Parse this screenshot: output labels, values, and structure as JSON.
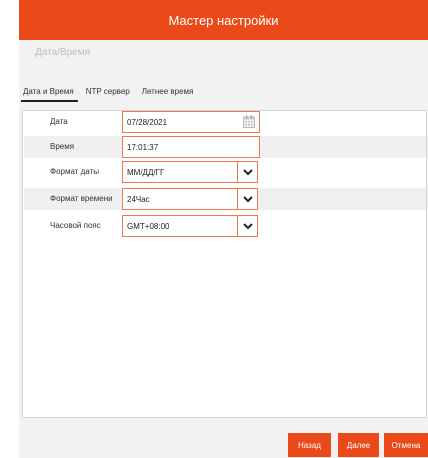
{
  "window": {
    "title": "Мастер настройки"
  },
  "section": {
    "title": "Дата/Время"
  },
  "tabs": [
    {
      "label": "Дата и Время"
    },
    {
      "label": "NTP сервер"
    },
    {
      "label": "Летнее время"
    }
  ],
  "form": {
    "date": {
      "label": "Дата",
      "value": "07/28/2021",
      "icon": "calendar-icon"
    },
    "time": {
      "label": "Время",
      "value": "17:01:37"
    },
    "date_format": {
      "label": "Формат даты",
      "value": "ММ/ДД/ГГ"
    },
    "time_format": {
      "label": "Формат времени",
      "value": "24Час"
    },
    "timezone": {
      "label": "Часовой пояс",
      "value": "GMT+08:00"
    }
  },
  "buttons": {
    "back": "Назад",
    "next": "Далее",
    "cancel": "Отмена"
  },
  "colors": {
    "accent": "#ea4a1a",
    "field_border": "#ee7a45"
  }
}
